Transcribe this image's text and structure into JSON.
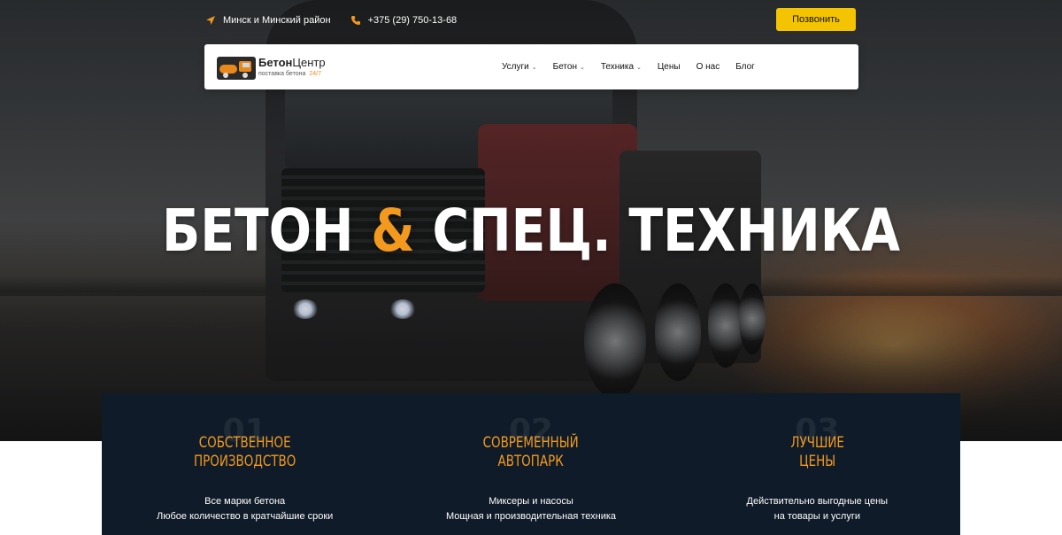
{
  "topbar": {
    "location": "Минск и Минский район",
    "phone": "+375 (29) 750-13-68",
    "call_button": "Позвонить"
  },
  "logo": {
    "name_bold": "Бетон",
    "name_light": "Центр",
    "tagline": "поставка бетона",
    "tagline_accent": "24/7"
  },
  "nav": {
    "items": [
      {
        "label": "Услуги",
        "dropdown": true
      },
      {
        "label": "Бетон",
        "dropdown": true
      },
      {
        "label": "Техника",
        "dropdown": true
      },
      {
        "label": "Цены",
        "dropdown": false
      },
      {
        "label": "О нас",
        "dropdown": false
      },
      {
        "label": "Блог",
        "dropdown": false
      }
    ]
  },
  "hero": {
    "title_part1": "БЕТОН",
    "ampersand": "&",
    "title_part2": "СПЕЦ. ТЕХНИКА"
  },
  "features": [
    {
      "num": "01",
      "title_line1": "Собственное",
      "title_line2": "производство",
      "desc_line1": "Все марки бетона",
      "desc_line2": "Любое количество в кратчайшие сроки"
    },
    {
      "num": "02",
      "title_line1": "Современный",
      "title_line2": "автопарк",
      "desc_line1": "Миксеры и насосы",
      "desc_line2": "Мощная и производительная техника"
    },
    {
      "num": "03",
      "title_line1": "Лучшие",
      "title_line2": "цены",
      "desc_line1": "Действительно выгодные цены",
      "desc_line2": "на товары и услуги"
    }
  ],
  "colors": {
    "accent_orange": "#f39a1e",
    "button_yellow": "#f5c400",
    "features_bg": "#0f1b28"
  },
  "icons": {
    "location": "location-arrow-icon",
    "phone": "phone-icon",
    "chevron": "chevron-down-icon"
  }
}
